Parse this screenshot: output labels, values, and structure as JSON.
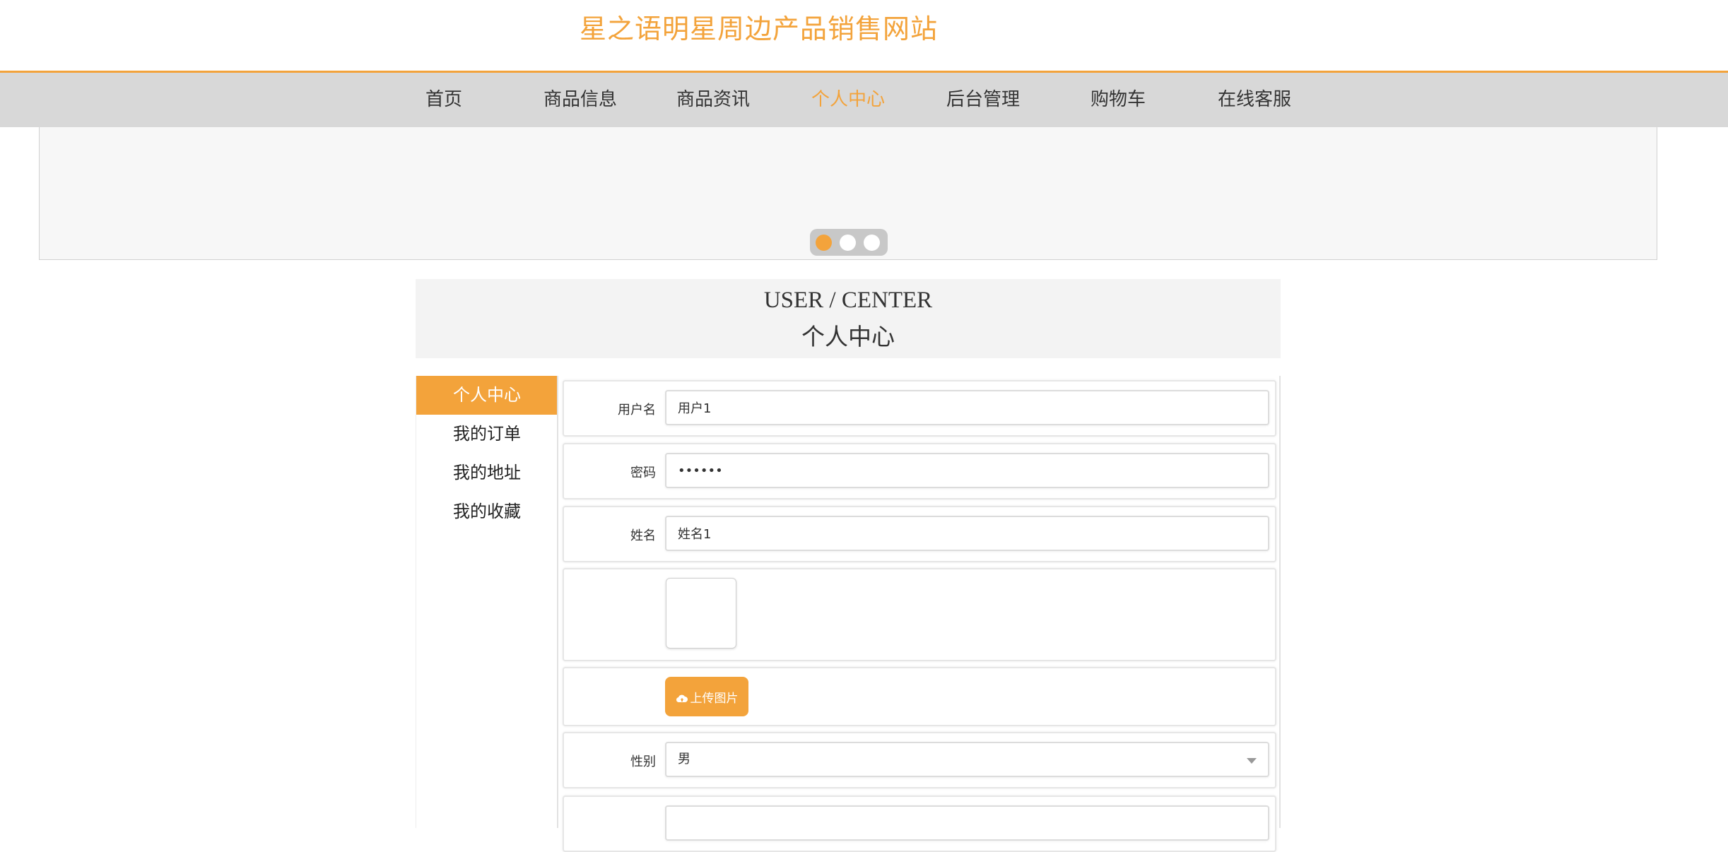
{
  "site": {
    "title": "星之语明星周边产品销售网站"
  },
  "nav": {
    "items": [
      {
        "label": "首页"
      },
      {
        "label": "商品信息"
      },
      {
        "label": "商品资讯"
      },
      {
        "label": "个人中心"
      },
      {
        "label": "后台管理"
      },
      {
        "label": "购物车"
      },
      {
        "label": "在线客服"
      }
    ],
    "active_index": 3
  },
  "carousel": {
    "slide_count": 3,
    "active_slide": 1
  },
  "section": {
    "title_en": "USER / CENTER",
    "title_zh": "个人中心"
  },
  "sidebar": {
    "items": [
      {
        "label": "个人中心"
      },
      {
        "label": "我的订单"
      },
      {
        "label": "我的地址"
      },
      {
        "label": "我的收藏"
      }
    ],
    "active_index": 0
  },
  "form": {
    "username_label": "用户名",
    "username_value": "用户1",
    "password_label": "密码",
    "password_value": "••••••",
    "name_label": "姓名",
    "name_value": "姓名1",
    "upload_label": "上传图片",
    "gender_label": "性别",
    "gender_value": "男"
  },
  "colors": {
    "accent": "#f3a33b",
    "nav_bg": "#d8d8d8",
    "banner_bg": "#f7f7f7"
  },
  "icons": {
    "upload": "cloud-upload-icon",
    "select": "chevron-down-icon"
  }
}
